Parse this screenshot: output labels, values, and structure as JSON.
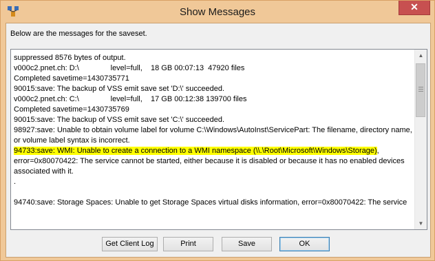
{
  "window": {
    "title": "Show Messages",
    "close_label": "✕"
  },
  "intro_text": "Below are the messages for the saveset.",
  "messages": [
    {
      "text": "suppressed 8576 bytes of output."
    },
    {
      "text": "v000c2.pnet.ch: D:\\               level=full,    18 GB 00:07:13  47920 files"
    },
    {
      "text": "Completed savetime=1430735771"
    },
    {
      "text": "90015:save: The backup of VSS emit save set 'D:\\' succeeded."
    },
    {
      "text": "v000c2.pnet.ch: C:\\               level=full,    17 GB 00:12:38 139700 files"
    },
    {
      "text": "Completed savetime=1430735769"
    },
    {
      "text": "90015:save: The backup of VSS emit save set 'C:\\' succeeded."
    },
    {
      "text": "98927:save: Unable to obtain volume label for volume C:\\Windows\\AutoInst\\ServicePart: The filename, directory name,"
    },
    {
      "text": "or volume label syntax is incorrect."
    },
    {
      "text_hl": "94733:save: WMI: Unable to create a connection to a WMI namespace (\\\\.\\Root\\Microsoft\\Windows\\Storage)",
      "text": ", "
    },
    {
      "text": "error=0x80070422: The service cannot be started, either because it is disabled or because it has no enabled devices"
    },
    {
      "text": "associated with it."
    },
    {
      "text": "."
    },
    {
      "text": ""
    },
    {
      "text": "94740:save: Storage Spaces: Unable to get Storage Spaces virtual disks information, error=0x80070422: The service"
    }
  ],
  "buttons": {
    "get_client_log": "Get Client Log",
    "print": "Print",
    "save": "Save",
    "ok": "OK"
  }
}
